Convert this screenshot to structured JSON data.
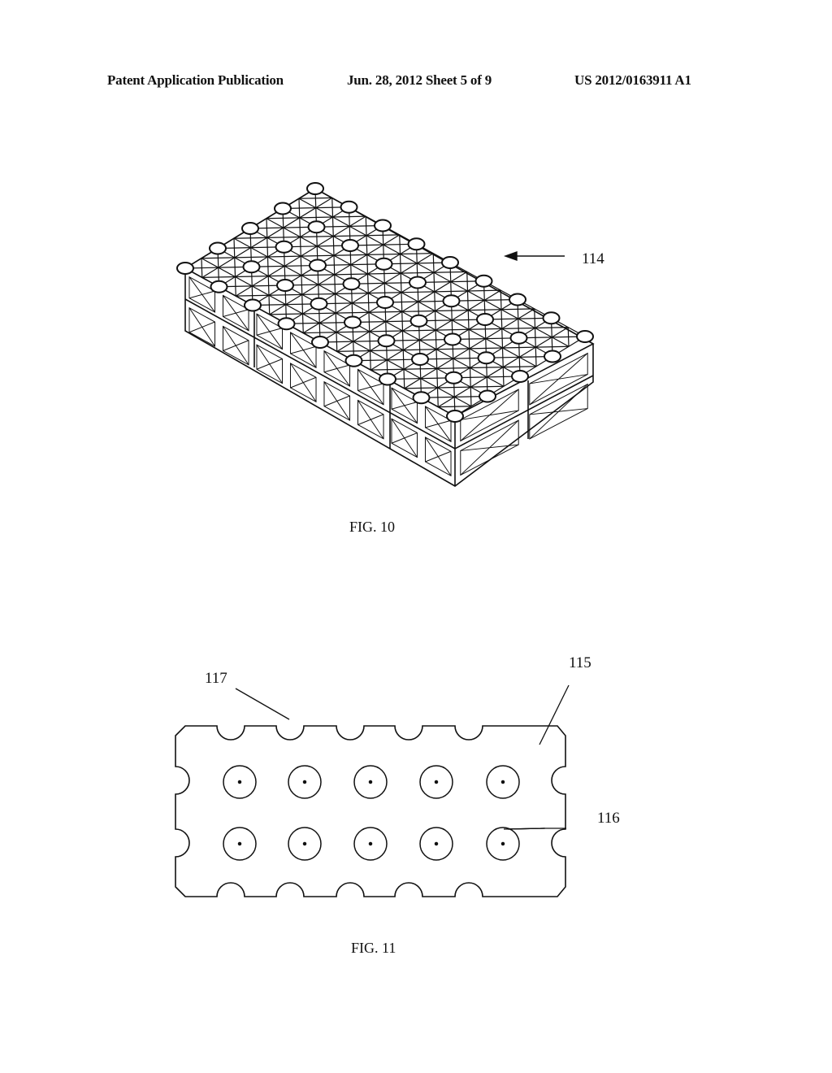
{
  "header": {
    "publication": "Patent Application Publication",
    "date_sheet": "Jun. 28, 2012  Sheet 5 of 9",
    "number": "US 2012/0163911 A1"
  },
  "figures": [
    {
      "id": "fig10",
      "caption": "FIG. 10",
      "refs": [
        "114"
      ],
      "description": "Isometric view of stacked modular lattice crate blocks"
    },
    {
      "id": "fig11",
      "caption": "FIG. 11",
      "refs": [
        "115",
        "116",
        "117"
      ],
      "description": "Plan view of plate with 2x5 circular holes and scalloped edges"
    }
  ]
}
